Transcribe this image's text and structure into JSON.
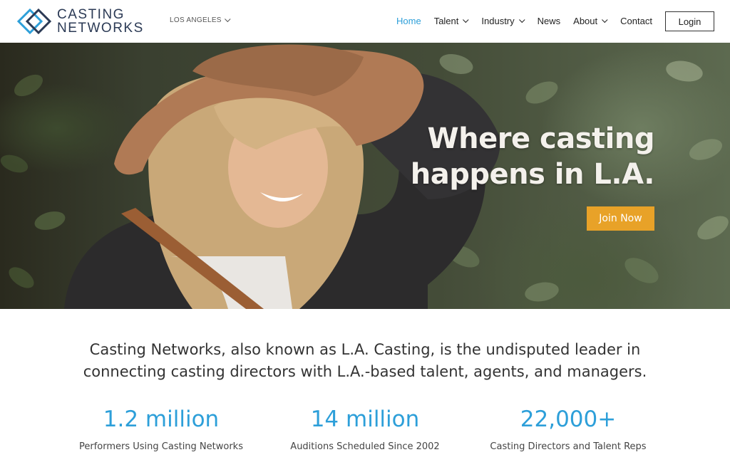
{
  "header": {
    "logo_line1": "CASTING",
    "logo_line2": "NETWORKS",
    "city": "LOS ANGELES",
    "nav": [
      {
        "label": "Home",
        "active": true,
        "dropdown": false
      },
      {
        "label": "Talent",
        "active": false,
        "dropdown": true
      },
      {
        "label": "Industry",
        "active": false,
        "dropdown": true
      },
      {
        "label": "News",
        "active": false,
        "dropdown": false
      },
      {
        "label": "About",
        "active": false,
        "dropdown": true
      },
      {
        "label": "Contact",
        "active": false,
        "dropdown": false
      }
    ],
    "login_label": "Login"
  },
  "hero": {
    "title_line1": "Where casting",
    "title_line2": "happens in L.A.",
    "join_label": "Join Now"
  },
  "intro": {
    "line1": "Casting Networks, also known as L.A. Casting, is the undisputed leader in",
    "line2": "connecting casting directors with L.A.-based talent, agents, and managers."
  },
  "stats": [
    {
      "number": "1.2 million",
      "label": "Performers Using Casting Networks"
    },
    {
      "number": "14 million",
      "label": "Auditions Scheduled Since 2002"
    },
    {
      "number": "22,000+",
      "label": "Casting Directors and Talent Reps"
    }
  ],
  "colors": {
    "accent_blue": "#2d9fd9",
    "join_orange": "#e8a228",
    "logo_navy": "#2b3a55"
  }
}
